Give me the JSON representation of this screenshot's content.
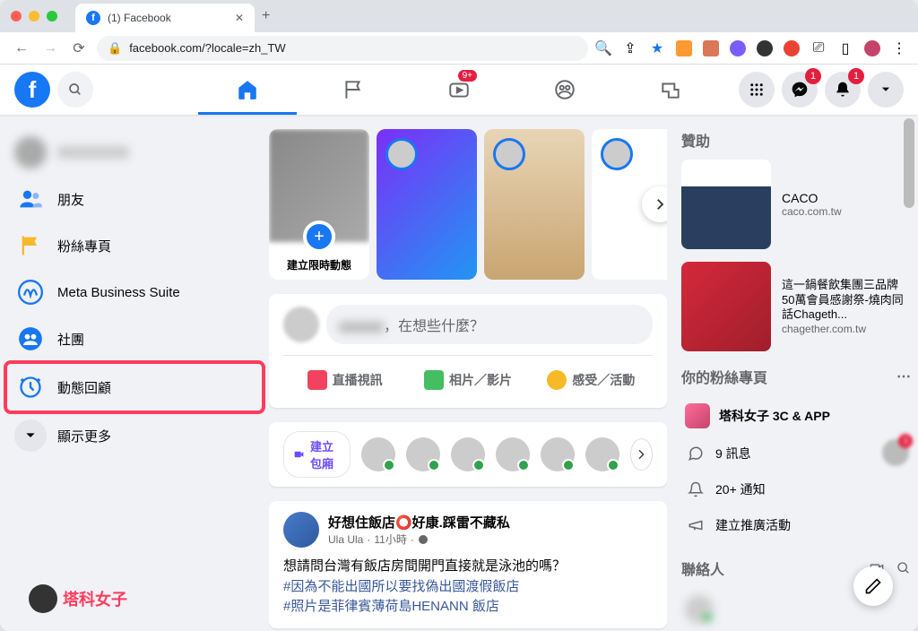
{
  "browser": {
    "tab_title": "(1) Facebook",
    "url": "facebook.com/?locale=zh_TW"
  },
  "fb_nav": {
    "watch_badge": "9+"
  },
  "notifications": {
    "messenger": "1",
    "bell": "1"
  },
  "sidebar": {
    "items": [
      {
        "label": "",
        "icon": "user"
      },
      {
        "label": "朋友",
        "icon": "friends"
      },
      {
        "label": "粉絲專頁",
        "icon": "flag"
      },
      {
        "label": "Meta Business Suite",
        "icon": "meta"
      },
      {
        "label": "社團",
        "icon": "groups"
      },
      {
        "label": "動態回顧",
        "icon": "memories"
      },
      {
        "label": "顯示更多",
        "icon": "more"
      }
    ]
  },
  "stories": {
    "create_label": "建立限時動態"
  },
  "composer": {
    "placeholder": "，在想些什麼？",
    "actions": {
      "live": "直播視訊",
      "photo": "相片／影片",
      "feeling": "感受／活動"
    }
  },
  "rooms": {
    "create_label": "建立包廂"
  },
  "post": {
    "page_name": "好想住飯店⭕好康.踩雷不藏私",
    "author": "Ula Ula",
    "time": "11小時",
    "body_line1": "想請問台灣有飯店房間開門直接就是泳池的嗎？",
    "hashtag1": "#因為不能出國所以要找偽出國渡假飯店",
    "hashtag2": "#照片是菲律賓薄荷島HENANN 飯店"
  },
  "right": {
    "sponsored_heading": "贊助",
    "ads": [
      {
        "title": "CACO",
        "domain": "caco.com.tw"
      },
      {
        "title": "這一鍋餐飲集團三品牌50萬會員感謝祭-燒肉同話Chageth...",
        "domain": "chagether.com.tw"
      }
    ],
    "pages_heading": "你的粉絲專頁",
    "page_name": "塔科女子 3C & APP",
    "page_items": {
      "messages": "9 訊息",
      "notifications": "20+ 通知",
      "promote": "建立推廣活動"
    },
    "contacts_heading": "聯絡人"
  },
  "watermark": "塔科女子"
}
